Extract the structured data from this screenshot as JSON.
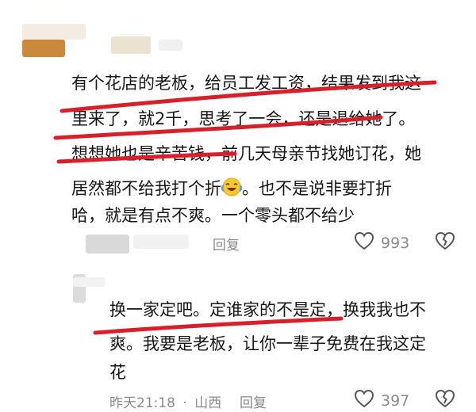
{
  "comment1": {
    "lines": [
      "有个花店的老板，给员工发工资，结果发到我这",
      "里来了，就2千，思考了一会，还是退给她了。",
      "想想她也是辛苦钱，前几天母亲节找她订花，她",
      "居然都不给我打个折",
      "。也不是说非要打折",
      "哈，就是有点不爽。一个零头都不给少"
    ],
    "reply_label": "回复",
    "like_count": "993",
    "emoji_icon": "laughing-crying-emoji"
  },
  "comment2": {
    "lines": [
      "换一家定吧。定谁家的不是定，换我我也不",
      "爽。我要是老板，让你一辈子免费在我这定",
      "花"
    ],
    "time": "昨天21:18",
    "separator": "·",
    "location": "山西",
    "reply_label": "回复",
    "like_count": "397"
  },
  "colors": {
    "annotation_red": "#d8202a",
    "text": "#161616",
    "meta": "#8a8a8a"
  }
}
